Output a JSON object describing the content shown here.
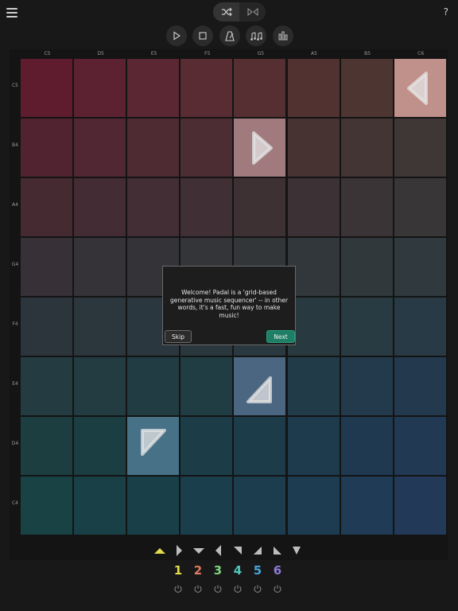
{
  "toolbar": {
    "menu_icon": "hamburger-icon",
    "help_label": "?",
    "random_icon": "shuffle-icon",
    "mirror_icon": "mirror-icon",
    "play_icon": "play-icon",
    "stop_icon": "stop-icon",
    "metronome_icon": "metronome-icon",
    "notes_icon": "notes-icon",
    "mixer_icon": "mixer-icon"
  },
  "grid": {
    "columns": [
      "C5",
      "D5",
      "E5",
      "F5",
      "G5",
      "A5",
      "B5",
      "C6"
    ],
    "rows": [
      "C5",
      "B4",
      "A4",
      "G4",
      "F4",
      "E4",
      "D4",
      "C4"
    ],
    "colors": [
      [
        "#5e1c2e",
        "#5d2232",
        "#5b2733",
        "#582c32",
        "#552f31",
        "#513230",
        "#4d3631",
        "#c0908a"
      ],
      [
        "#512330",
        "#502733",
        "#4e2a33",
        "#4c2d33",
        "#a07a7d",
        "#473332",
        "#433533",
        "#3f3736"
      ],
      [
        "#452a31",
        "#432c33",
        "#422e34",
        "#402f34",
        "#3e3134",
        "#3c3235",
        "#3a3437",
        "#393638"
      ],
      [
        "#373037",
        "#353238",
        "#343438",
        "#333538",
        "#323639",
        "#31373a",
        "#30383b",
        "#30393d"
      ],
      [
        "#2d353c",
        "#2c363d",
        "#2b373e",
        "#2a383e",
        "#29393f",
        "#283a40",
        "#283a42",
        "#283a45"
      ],
      [
        "#233b41",
        "#223c42",
        "#213d43",
        "#213d44",
        "#4b6680",
        "#213b48",
        "#223a4b",
        "#23394e"
      ],
      [
        "#1c3e40",
        "#1b3e43",
        "#467187",
        "#1c3d47",
        "#1c3c4a",
        "#1d3b4d",
        "#1f3a50",
        "#213953"
      ],
      [
        "#194245",
        "#194046",
        "#193f48",
        "#1a3e4b",
        "#1b3d4e",
        "#1d3c51",
        "#1f3b55",
        "#223a58"
      ]
    ],
    "arrows": [
      {
        "row": 0,
        "col": 7,
        "direction": "left",
        "icon": "arrow-left-icon"
      },
      {
        "row": 1,
        "col": 4,
        "direction": "right",
        "icon": "arrow-right-icon"
      },
      {
        "row": 5,
        "col": 4,
        "direction": "up-left",
        "icon": "arrow-up-left-icon"
      },
      {
        "row": 6,
        "col": 2,
        "direction": "down-right",
        "icon": "arrow-down-right-icon"
      }
    ]
  },
  "dialog": {
    "message": "Welcome! Padal is a 'grid-based generative music sequencer' -- in other words, it's a fast, fun way to make music!",
    "skip_label": "Skip",
    "next_label": "Next"
  },
  "directions": [
    {
      "icon": "arrow-up-icon",
      "selected": true
    },
    {
      "icon": "arrow-right-icon",
      "selected": false
    },
    {
      "icon": "arrow-down-icon",
      "selected": false
    },
    {
      "icon": "arrow-left-icon",
      "selected": false
    },
    {
      "icon": "arrow-up-left-icon",
      "selected": false
    },
    {
      "icon": "arrow-up-right-icon",
      "selected": false
    },
    {
      "icon": "arrow-down-right-icon",
      "selected": false
    },
    {
      "icon": "arrow-down-left-icon",
      "selected": false
    }
  ],
  "voices": [
    {
      "label": "1",
      "color": "#e3dc4a"
    },
    {
      "label": "2",
      "color": "#e07a5c"
    },
    {
      "label": "3",
      "color": "#7ed27e"
    },
    {
      "label": "4",
      "color": "#4fc7b8"
    },
    {
      "label": "5",
      "color": "#4aa2d8"
    },
    {
      "label": "6",
      "color": "#8f7ad8"
    }
  ],
  "accent": "#1f7e66"
}
